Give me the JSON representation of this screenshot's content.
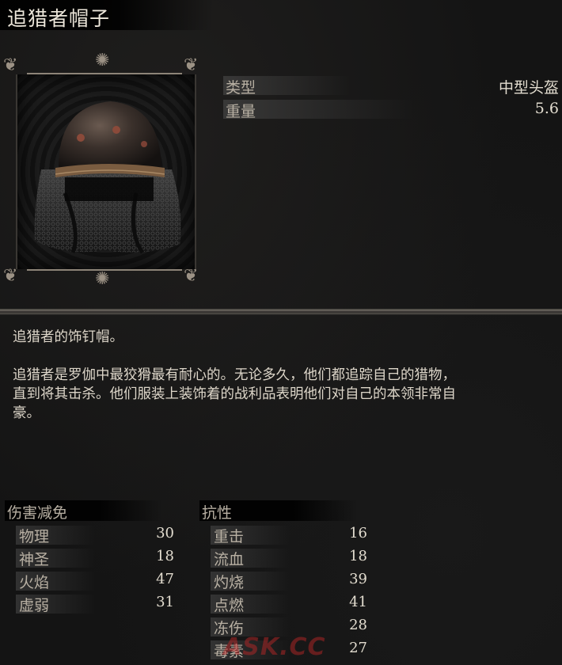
{
  "item": {
    "title": "追猎者帽子"
  },
  "stats": [
    {
      "label": "类型",
      "value": "中型头盔"
    },
    {
      "label": "重量",
      "value": "5.6"
    }
  ],
  "description": {
    "line1": "追猎者的饰钉帽。",
    "paragraph": "追猎者是罗伽中最狡猾最有耐心的。无论多久，他们都追踪自己的猎物，\n直到将其击杀。他们服装上装饰着的战利品表明他们对自己的本领非常自\n豪。"
  },
  "damage_reduction": {
    "header": "伤害减免",
    "rows": [
      {
        "label": "物理",
        "value": "30"
      },
      {
        "label": "神圣",
        "value": "18"
      },
      {
        "label": "火焰",
        "value": "47"
      },
      {
        "label": "虚弱",
        "value": "31"
      }
    ]
  },
  "resistance": {
    "header": "抗性",
    "rows": [
      {
        "label": "重击",
        "value": "16"
      },
      {
        "label": "流血",
        "value": "18"
      },
      {
        "label": "灼烧",
        "value": "39"
      },
      {
        "label": "点燃",
        "value": "41"
      },
      {
        "label": "冻伤",
        "value": "28"
      },
      {
        "label": "毒素",
        "value": "27"
      }
    ]
  },
  "watermark": "ASK.CC",
  "colors": {
    "background": "#161616",
    "text": "#d8d2c6",
    "label": "#b8b0a3",
    "frame": "#8d8478"
  },
  "icons": {
    "helmet": "helmet-icon",
    "frame_ornament": "filigree-ornament-icon"
  }
}
